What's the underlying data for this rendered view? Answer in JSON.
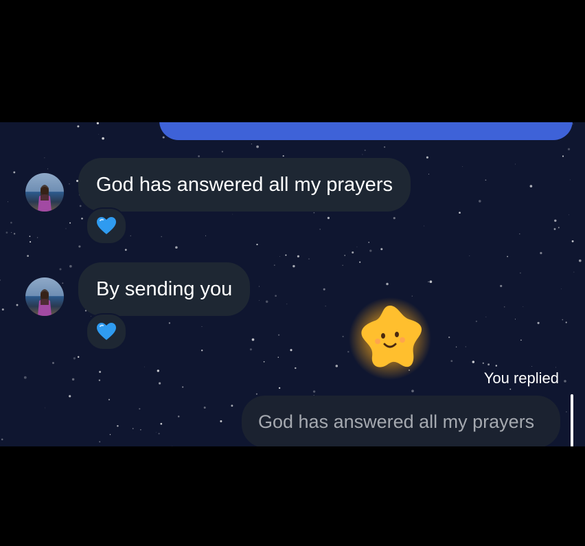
{
  "conversation": {
    "messages": [
      {
        "sender": "other",
        "text": "God has answered all my prayers",
        "reaction": "blue-heart"
      },
      {
        "sender": "other",
        "text": "By sending you",
        "reaction": "blue-heart"
      }
    ],
    "sticker": "wish-star-sticker",
    "reply": {
      "label": "You replied",
      "quoted_text": "God has answered all my prayers"
    }
  },
  "colors": {
    "background": "#0f1630",
    "sent_bubble": "#3e62d8",
    "received_bubble": "#1e2733",
    "reaction_heart": "#2f9bf0"
  }
}
